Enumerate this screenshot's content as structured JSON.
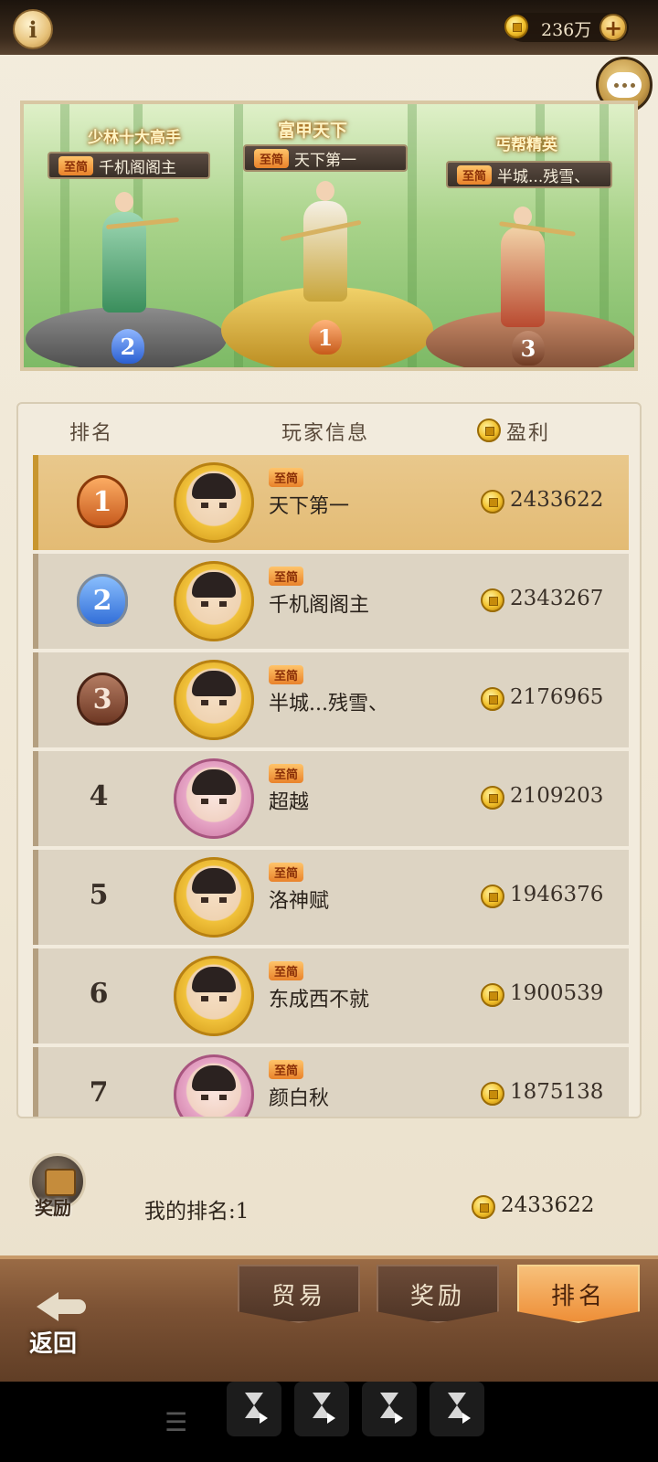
{
  "topbar": {
    "info_icon": "info-icon",
    "coins": "236万",
    "plus_label": "+"
  },
  "banner": {
    "podium": [
      {
        "rank": "2",
        "title": "少林十大高手",
        "vip": "至简",
        "name": "千机阁阁主"
      },
      {
        "rank": "1",
        "title": "富甲天下",
        "vip": "至简",
        "name": "天下第一"
      },
      {
        "rank": "3",
        "title": "丐帮精英",
        "vip": "至简",
        "name": "半城...残雪、"
      }
    ]
  },
  "table": {
    "headers": {
      "rank": "排名",
      "player": "玩家信息",
      "profit": "盈利"
    },
    "rows": [
      {
        "rank": "1",
        "vip": "至简",
        "name": "天下第一",
        "profit": "2433622"
      },
      {
        "rank": "2",
        "vip": "至简",
        "name": "千机阁阁主",
        "profit": "2343267"
      },
      {
        "rank": "3",
        "vip": "至简",
        "name": "半城...残雪、",
        "profit": "2176965"
      },
      {
        "rank": "4",
        "vip": "至简",
        "name": "超越",
        "profit": "2109203"
      },
      {
        "rank": "5",
        "vip": "至简",
        "name": "洛神赋",
        "profit": "1946376"
      },
      {
        "rank": "6",
        "vip": "至简",
        "name": "东成西不就",
        "profit": "1900539"
      },
      {
        "rank": "7",
        "vip": "至简",
        "name": "颜白秋",
        "profit": "1875138"
      }
    ]
  },
  "footer": {
    "reward_label": "奖励",
    "my_rank": "我的排名:1",
    "my_profit": "2433622"
  },
  "tabs": {
    "back": "返回",
    "trade": "贸易",
    "reward": "奖励",
    "ranking": "排名"
  },
  "colors": {
    "accent": "#ee8f38",
    "gold": "#f2c12c",
    "panel": "#f2ebdd"
  }
}
